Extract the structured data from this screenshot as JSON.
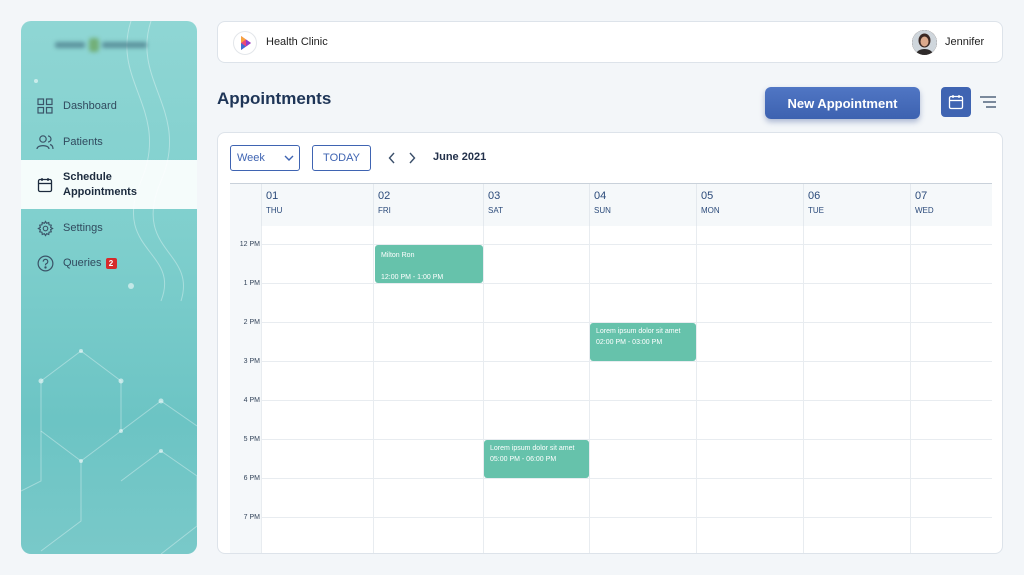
{
  "sidebar": {
    "items": [
      {
        "label": "Dashboard",
        "icon": "grid-icon",
        "active": false
      },
      {
        "label": "Patients",
        "icon": "users-icon",
        "active": false
      },
      {
        "label": "Schedule Appointments",
        "icon": "calendar-icon",
        "active": true
      },
      {
        "label": "Settings",
        "icon": "gear-icon",
        "active": false
      },
      {
        "label": "Queries",
        "icon": "question-icon",
        "active": false,
        "badge": "2"
      }
    ]
  },
  "header": {
    "brand": "Health Clinic",
    "user": "Jennifer"
  },
  "page": {
    "title": "Appointments",
    "new_button": "New Appointment"
  },
  "calendar": {
    "view": "Week",
    "today_label": "TODAY",
    "month": "June 2021",
    "days": [
      {
        "num": "01",
        "name": "THU"
      },
      {
        "num": "02",
        "name": "FRI"
      },
      {
        "num": "03",
        "name": "SAT"
      },
      {
        "num": "04",
        "name": "SUN"
      },
      {
        "num": "05",
        "name": "MON"
      },
      {
        "num": "06",
        "name": "TUE"
      },
      {
        "num": "07",
        "name": "WED"
      }
    ],
    "hours": [
      "12 PM",
      "1 PM",
      "2 PM",
      "3 PM",
      "4 PM",
      "5 PM",
      "6 PM",
      "7 PM"
    ],
    "events": [
      {
        "title": "Milton Ron",
        "time": "12:00 PM - 1:00 PM"
      },
      {
        "title": "Lorem ipsum dolor sit amet",
        "time": "02:00 PM - 03:00 PM"
      },
      {
        "title": "Lorem ipsum dolor sit amet",
        "time": "05:00 PM - 06:00 PM"
      }
    ]
  },
  "colors": {
    "primary": "#3f64b2",
    "event": "#66c2ab",
    "badge": "#d62a2a",
    "sidebar": "#7fcfcd"
  }
}
